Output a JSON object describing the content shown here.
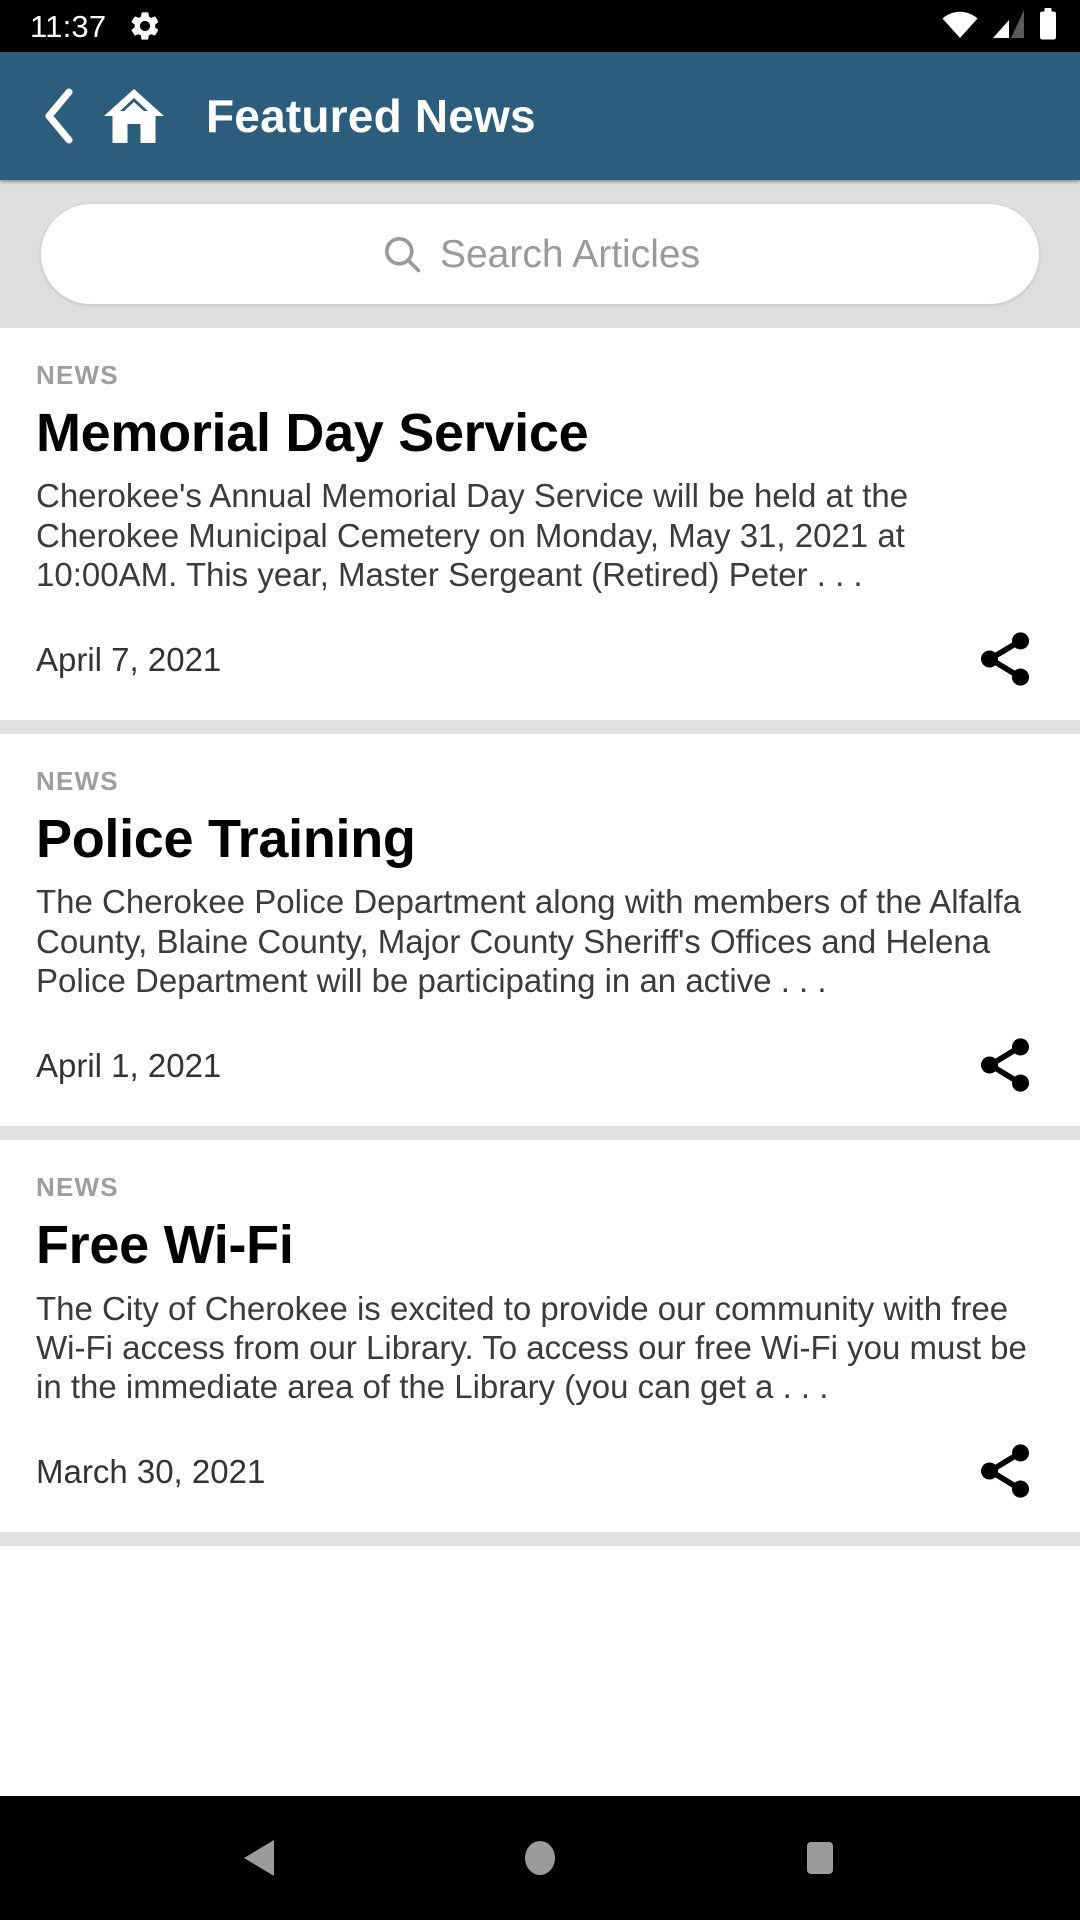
{
  "status_bar": {
    "time": "11:37",
    "gear_icon": "gear-icon",
    "wifi_icon": "wifi-icon",
    "signal_icon": "cellular-signal-icon",
    "battery_icon": "battery-full-icon"
  },
  "app_bar": {
    "back_icon": "chevron-left-icon",
    "home_icon": "home-icon",
    "title": "Featured News"
  },
  "search": {
    "icon": "search-icon",
    "placeholder": "Search Articles",
    "value": ""
  },
  "articles": [
    {
      "kicker": "NEWS",
      "headline": "Memorial Day Service",
      "summary": "Cherokee's Annual Memorial Day Service will be held at the Cherokee Municipal Cemetery on Monday, May 31, 2021 at 10:00AM.  This year, Master Sergeant (Retired) Peter . . .",
      "date": "April 7, 2021",
      "share_icon": "share-icon"
    },
    {
      "kicker": "NEWS",
      "headline": "Police Training",
      "summary": "The Cherokee Police Department along with members of the Alfalfa County, Blaine County, Major County Sheriff's Offices and Helena Police Department will be participating in an active . . .",
      "date": "April 1, 2021",
      "share_icon": "share-icon"
    },
    {
      "kicker": "NEWS",
      "headline": "Free Wi-Fi",
      "summary": "The City of Cherokee is excited to provide our community with free Wi-Fi access from our Library.  To access our free Wi-Fi you must be in the immediate area of the Library (you can get a . . .",
      "date": "March 30, 2021",
      "share_icon": "share-icon"
    }
  ],
  "nav_bar": {
    "back_label": "back-triangle-icon",
    "home_label": "home-circle-icon",
    "recents_label": "recents-square-icon"
  },
  "colors": {
    "appbar": "#2c5d7c",
    "search_zone": "#dedede",
    "divider": "#e0e0e0",
    "kicker": "#9e9e9e",
    "placeholder": "#9a9a9a"
  }
}
